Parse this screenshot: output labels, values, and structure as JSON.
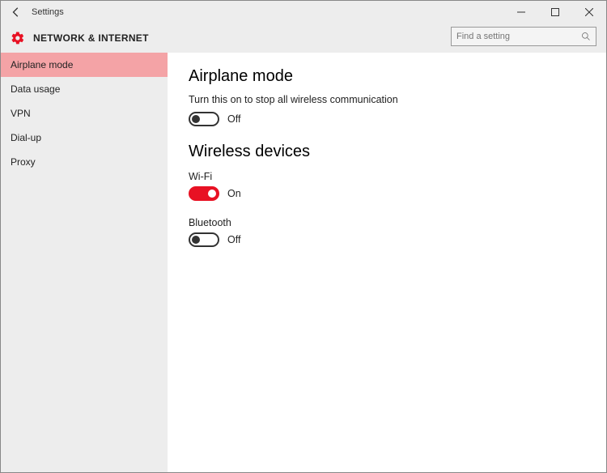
{
  "window": {
    "title": "Settings"
  },
  "header": {
    "title": "NETWORK & INTERNET",
    "search_placeholder": "Find a setting"
  },
  "sidebar": {
    "items": [
      {
        "label": "Airplane mode",
        "selected": true
      },
      {
        "label": "Data usage",
        "selected": false
      },
      {
        "label": "VPN",
        "selected": false
      },
      {
        "label": "Dial-up",
        "selected": false
      },
      {
        "label": "Proxy",
        "selected": false
      }
    ]
  },
  "content": {
    "airplane": {
      "heading": "Airplane mode",
      "description": "Turn this on to stop all wireless communication",
      "toggle_state": "Off"
    },
    "wireless": {
      "heading": "Wireless devices",
      "wifi_label": "Wi-Fi",
      "wifi_state": "On",
      "bluetooth_label": "Bluetooth",
      "bluetooth_state": "Off"
    }
  }
}
